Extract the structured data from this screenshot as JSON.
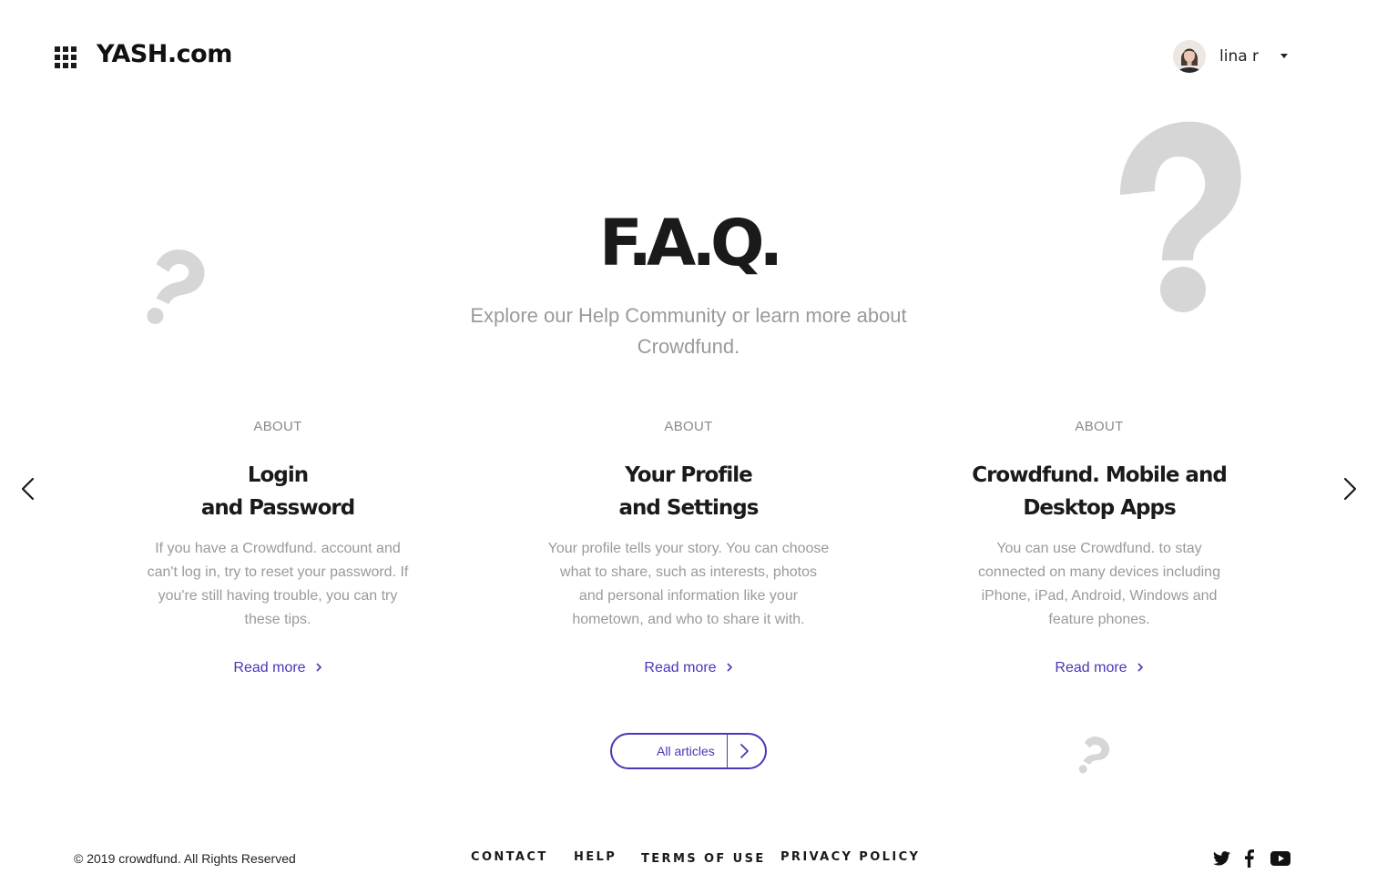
{
  "header": {
    "brand": "YASH.com",
    "user_name": "lina r",
    "menu_icon": "grid-menu-icon",
    "dropdown_icon": "caret-down-icon"
  },
  "hero": {
    "title": "F.A.Q.",
    "subtitle": "Explore our Help Community or learn more about Crowdfund."
  },
  "cards": [
    {
      "kicker": "ABOUT",
      "title_line1": "Login",
      "title_line2": "and Password",
      "body": "If you have a Crowdfund. account and can't log in, try to reset your password. If you're still having trouble, you can try these tips.",
      "link": "Read more"
    },
    {
      "kicker": "ABOUT",
      "title_line1": "Your Profile",
      "title_line2": "and Settings",
      "body": "Your profile tells your story. You can choose what to share, such as interests, photos and personal information like your hometown, and who to share it with.",
      "link": "Read more"
    },
    {
      "kicker": "ABOUT",
      "title_line1": "Crowdfund. Mobile and",
      "title_line2": "Desktop Apps",
      "body": "You can use Crowdfund. to stay connected on many devices including iPhone, iPad, Android, Windows and feature phones.",
      "link": "Read more"
    }
  ],
  "all_articles_label": "All articles",
  "footer": {
    "copyright": "© 2019 crowdfund. All Rights Reserved",
    "links": [
      "CONTACT",
      "HELP",
      "TERMS OF USE",
      "PRIVACY POLICY"
    ],
    "social_icons": [
      "twitter-icon",
      "facebook-icon",
      "youtube-icon"
    ]
  },
  "colors": {
    "accent": "#4a36b8",
    "muted_text": "#9a9a9a",
    "decor_gray": "#d6d6d6",
    "heading": "#1a1a1a"
  }
}
